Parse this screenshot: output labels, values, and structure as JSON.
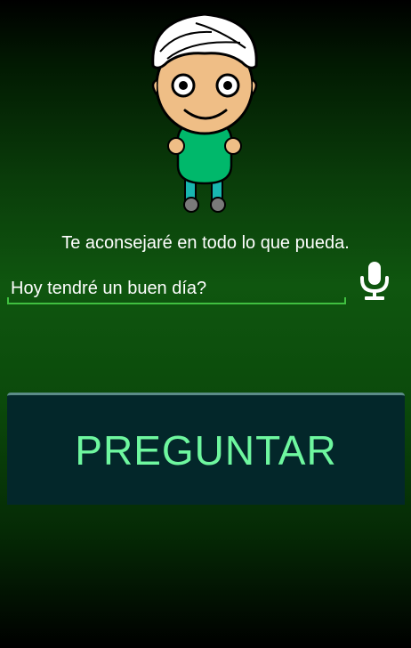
{
  "avatar": {
    "icon": "advisor-character-icon",
    "colors": {
      "turban": "#ffffff",
      "skin": "#efbe86",
      "shirt": "#00b86b",
      "pants": "#18b7b0",
      "shoes": "#7a7a7a"
    }
  },
  "subtitle": "Te aconsejaré en todo lo que pueda.",
  "question": {
    "value": "Hoy tendré un buen día?",
    "placeholder": ""
  },
  "mic": {
    "icon": "microphone-icon"
  },
  "ask_button": {
    "label": "PREGUNTAR"
  },
  "colors": {
    "accent_underline": "#40c040",
    "button_background": "#03272a",
    "button_text": "#6ef79f"
  }
}
